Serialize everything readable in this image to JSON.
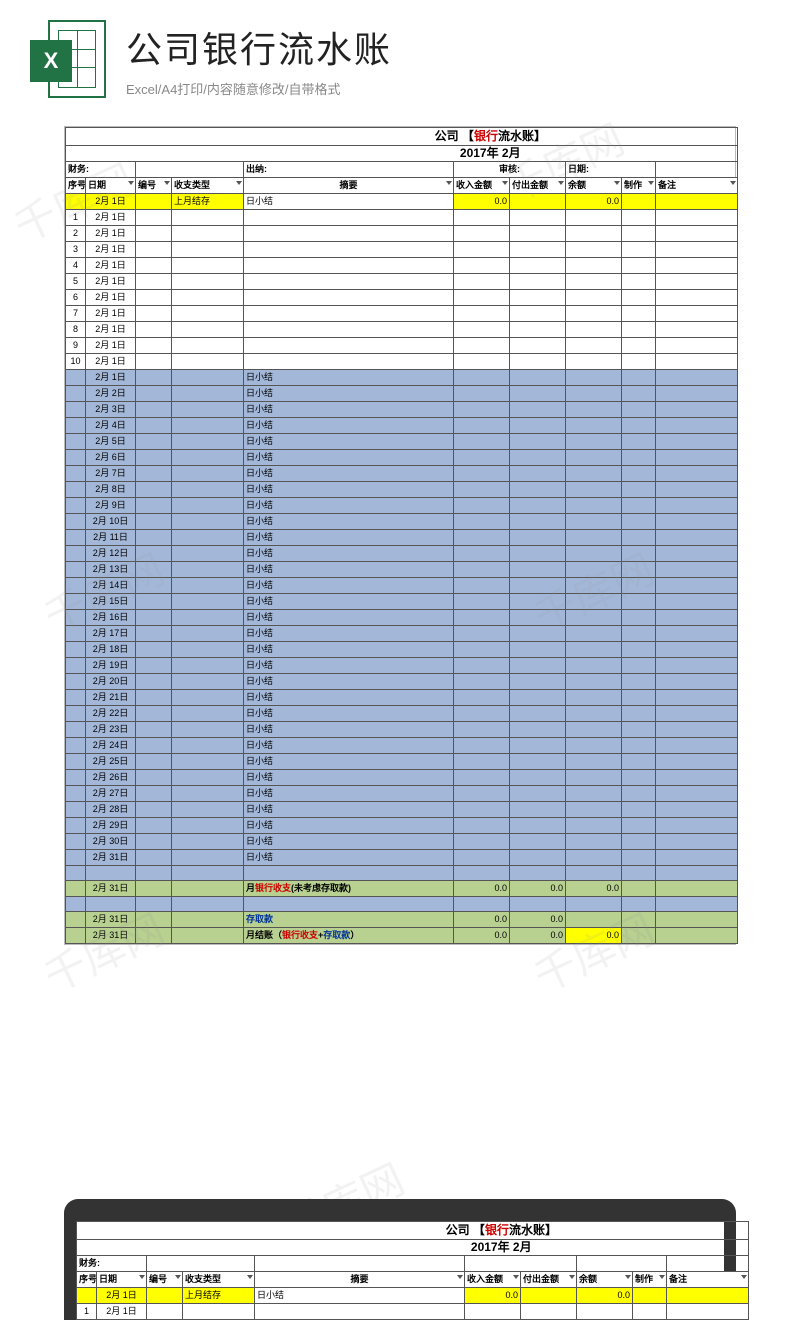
{
  "watermark": "千库网",
  "header": {
    "icon_letter": "X",
    "title": "公司银行流水账",
    "subtitle": "Excel/A4打印/内容随意修改/自带格式"
  },
  "sheet": {
    "title_prefix": "公司",
    "title_bracket_open": "【",
    "title_red": "银行",
    "title_black2": "流水账",
    "title_bracket_close": "】",
    "date_line": "2017年 2月",
    "labels": {
      "finance": "财务:",
      "cashier": "出纳:",
      "audit": "审核:",
      "date": "日期:"
    },
    "columns": {
      "seq": "序号",
      "date": "日期",
      "code": "编号",
      "type": "收支类型",
      "summary": "摘要",
      "income": "收入金额",
      "expense": "付出金额",
      "balance": "余额",
      "maker": "制作",
      "note": "备注"
    },
    "first_row": {
      "date": "2月 1日",
      "type": "上月结存",
      "summary": "日小结",
      "income": "0.0",
      "balance": "0.0"
    },
    "entry_rows": [
      {
        "seq": "1",
        "date": "2月 1日"
      },
      {
        "seq": "2",
        "date": "2月 1日"
      },
      {
        "seq": "3",
        "date": "2月 1日"
      },
      {
        "seq": "4",
        "date": "2月 1日"
      },
      {
        "seq": "5",
        "date": "2月 1日"
      },
      {
        "seq": "6",
        "date": "2月 1日"
      },
      {
        "seq": "7",
        "date": "2月 1日"
      },
      {
        "seq": "8",
        "date": "2月 1日"
      },
      {
        "seq": "9",
        "date": "2月 1日"
      },
      {
        "seq": "10",
        "date": "2月 1日"
      }
    ],
    "daily_rows": [
      "2月 1日",
      "2月 2日",
      "2月 3日",
      "2月 4日",
      "2月 5日",
      "2月 6日",
      "2月 7日",
      "2月 8日",
      "2月 9日",
      "2月 10日",
      "2月 11日",
      "2月 12日",
      "2月 13日",
      "2月 14日",
      "2月 15日",
      "2月 16日",
      "2月 17日",
      "2月 18日",
      "2月 19日",
      "2月 20日",
      "2月 21日",
      "2月 22日",
      "2月 23日",
      "2月 24日",
      "2月 25日",
      "2月 26日",
      "2月 27日",
      "2月 28日",
      "2月 29日",
      "2月 30日",
      "2月 31日"
    ],
    "daily_summary": "日小结",
    "footer": {
      "d": "2月  31日",
      "r1_pre": "月",
      "r1_red": "银行收支",
      "r1_post": "(未考虑存取款)",
      "r2": "存取款",
      "r3_pre": "月结账（",
      "r3_red": "银行收支",
      "r3_plus": "+",
      "r3_blue": "存取款",
      "r3_post": "）",
      "zero": "0.0"
    }
  }
}
